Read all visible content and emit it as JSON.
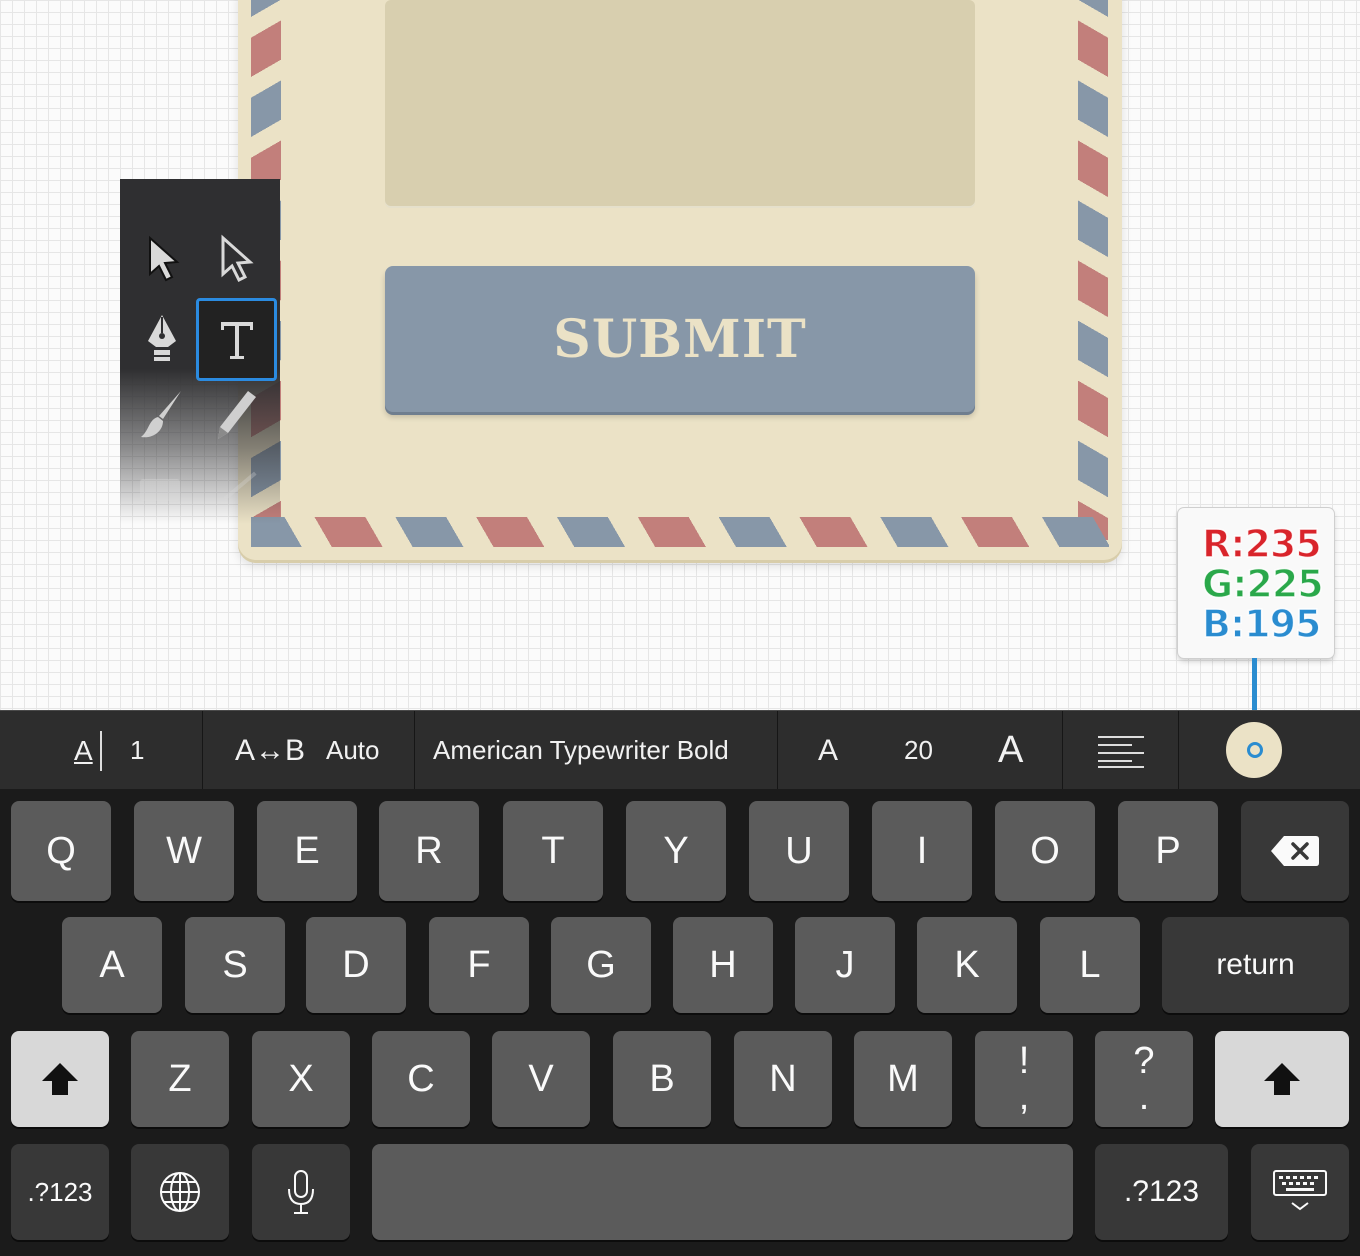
{
  "canvas": {
    "submit_label": "SUBMIT"
  },
  "tools": [
    {
      "id": "selection-tool",
      "icon": "arrow-filled-icon"
    },
    {
      "id": "direct-selection-tool",
      "icon": "arrow-outline-icon"
    },
    {
      "id": "pen-tool",
      "icon": "pen-nib-icon"
    },
    {
      "id": "type-tool",
      "icon": "text-t-icon",
      "selected": true
    },
    {
      "id": "brush-tool",
      "icon": "brush-icon"
    },
    {
      "id": "pencil-tool",
      "icon": "pencil-icon"
    }
  ],
  "color_picker": {
    "r_label": "R:235",
    "g_label": "G:225",
    "b_label": "B:195",
    "swatch_color": "#ebe2c6"
  },
  "format_toolbar": {
    "line_spacing_icon": "A",
    "line_spacing_value": "1",
    "tracking_icon": "A↔B",
    "tracking_value": "Auto",
    "font_name": "American Typewriter Bold",
    "size_small_icon": "A",
    "font_size": "20",
    "size_large_icon": "A"
  },
  "keyboard": {
    "row1": [
      "Q",
      "W",
      "E",
      "R",
      "T",
      "Y",
      "U",
      "I",
      "O",
      "P"
    ],
    "row2": [
      "A",
      "S",
      "D",
      "F",
      "G",
      "H",
      "J",
      "K",
      "L"
    ],
    "return_label": "return",
    "row3": [
      "Z",
      "X",
      "C",
      "V",
      "B",
      "N",
      "M"
    ],
    "punct1_top": "!",
    "punct1_bottom": ",",
    "punct2_top": "?",
    "punct2_bottom": ".",
    "numbers_left": ".?123",
    "numbers_right": ".?123"
  },
  "colors": {
    "envelope": "#ebe2c6",
    "stripe_red": "#c27f7b",
    "stripe_blue": "#8797a8",
    "accent_blue": "#2a8cd0"
  }
}
